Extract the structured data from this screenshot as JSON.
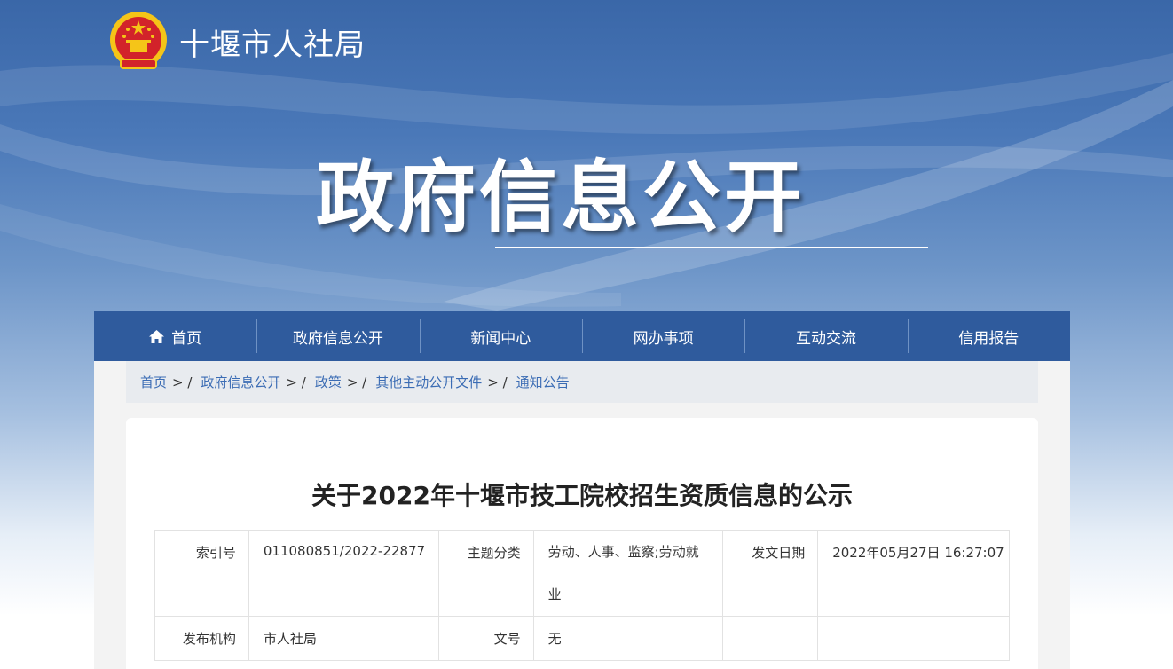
{
  "header": {
    "site_name": "十堰市人社局",
    "hero_title": "政府信息公开"
  },
  "nav": {
    "items": [
      {
        "label": "首页",
        "icon": "home-icon"
      },
      {
        "label": "政府信息公开"
      },
      {
        "label": "新闻中心"
      },
      {
        "label": "网办事项"
      },
      {
        "label": "互动交流"
      },
      {
        "label": "信用报告"
      }
    ]
  },
  "breadcrumb": {
    "items": [
      "首页",
      "政府信息公开",
      "政策",
      "其他主动公开文件",
      "通知公告"
    ],
    "separator": ">  /"
  },
  "article": {
    "title": "关于2022年十堰市技工院校招生资质信息的公示",
    "meta": {
      "index_label": "索引号",
      "index_value": "011080851/2022-22877",
      "subject_label": "主题分类",
      "subject_value": "劳动、人事、监察;劳动就业",
      "date_label": "发文日期",
      "date_value": "2022年05月27日 16:27:07",
      "publisher_label": "发布机构",
      "publisher_value": "市人社局",
      "doc_no_label": "文号",
      "doc_no_value": "无"
    }
  },
  "colors": {
    "nav_bg": "#2f5b9d",
    "link": "#3b6cb4",
    "emblem_red": "#d2232a",
    "emblem_gold": "#f5c518"
  }
}
